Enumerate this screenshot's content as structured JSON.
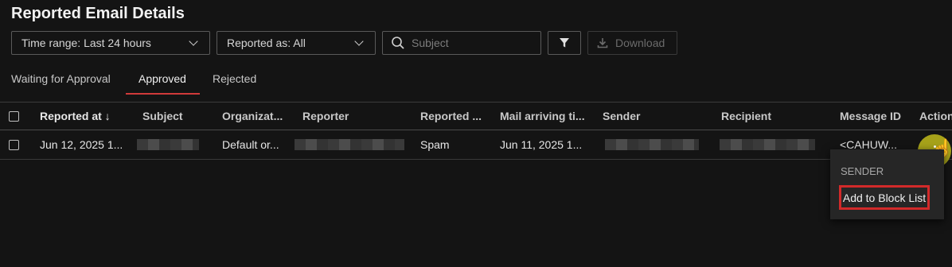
{
  "page": {
    "title": "Reported Email Details"
  },
  "filters": {
    "time_range": "Time range: Last 24 hours",
    "reported_as": "Reported as: All",
    "search_placeholder": "Subject",
    "download_label": "Download"
  },
  "tabs": [
    {
      "label": "Waiting for Approval",
      "selected": false
    },
    {
      "label": "Approved",
      "selected": true
    },
    {
      "label": "Rejected",
      "selected": false
    }
  ],
  "table": {
    "columns": [
      "Reported at ↓",
      "Subject",
      "Organizat...",
      "Reporter",
      "Reported ...",
      "Mail arriving ti...",
      "Sender",
      "Recipient",
      "Message ID",
      "Action"
    ],
    "rows": [
      {
        "reported_at": "Jun 12, 2025 1...",
        "organization": "Default or...",
        "reported_as": "Spam",
        "mail_arriving": "Jun 11, 2025 1...",
        "message_id": "<CAHUW..."
      }
    ]
  },
  "context_menu": {
    "section": "SENDER",
    "item": "Add to Block List"
  },
  "colors": {
    "background": "#141414",
    "tab_underline": "#d03a3a",
    "highlight_ring": "#d22a2a",
    "action_cursor_bg": "#a7a21a"
  },
  "icons": [
    "chevron-down-icon",
    "search-icon",
    "filter-icon",
    "download-icon",
    "sort-down-arrow-icon",
    "more-vertical-icon",
    "hand-pointer-icon"
  ]
}
